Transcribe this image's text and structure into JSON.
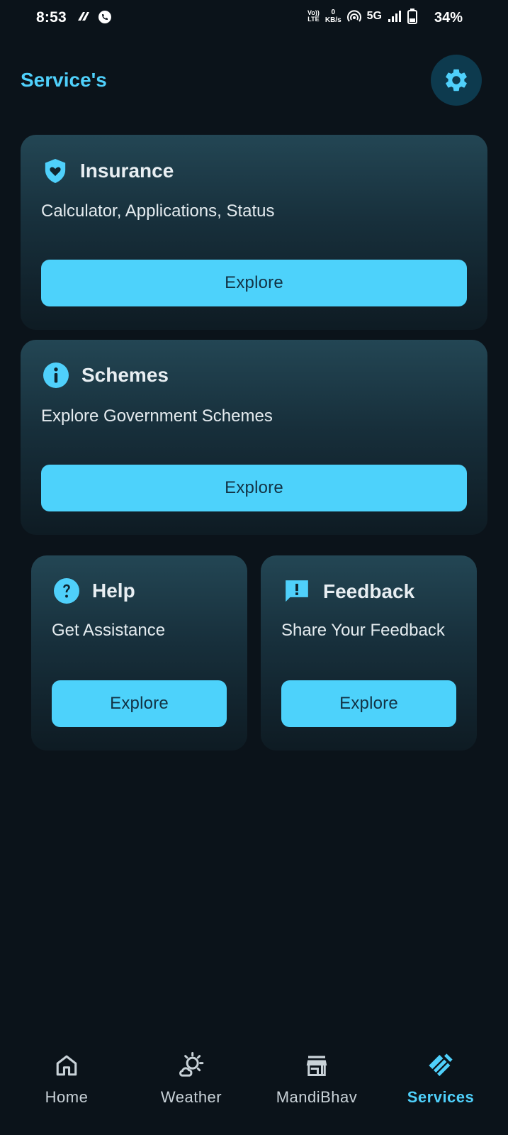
{
  "status_bar": {
    "time": "8:53",
    "volte_top": "Vo))",
    "volte_bottom": "LTE",
    "speed_value": "0",
    "speed_unit": "KB/s",
    "network": "5G",
    "battery": "34%"
  },
  "header": {
    "title": "Service's",
    "settings_icon": "gear-icon"
  },
  "cards": [
    {
      "id": "insurance",
      "icon": "shield-heart-icon",
      "title": "Insurance",
      "subtitle": "Calculator, Applications, Status",
      "button": "Explore"
    },
    {
      "id": "schemes",
      "icon": "info-icon",
      "title": "Schemes",
      "subtitle": "Explore Government Schemes",
      "button": "Explore"
    },
    {
      "id": "help",
      "icon": "help-circle-icon",
      "title": "Help",
      "subtitle": "Get Assistance",
      "button": "Explore"
    },
    {
      "id": "feedback",
      "icon": "feedback-icon",
      "title": "Feedback",
      "subtitle": "Share Your Feedback",
      "button": "Explore"
    }
  ],
  "bottom_nav": [
    {
      "label": "Home",
      "icon": "home-icon",
      "active": false
    },
    {
      "label": "Weather",
      "icon": "weather-icon",
      "active": false
    },
    {
      "label": "MandiBhav",
      "icon": "store-icon",
      "active": false
    },
    {
      "label": "Services",
      "icon": "services-icon",
      "active": true
    }
  ],
  "colors": {
    "background": "#0b131a",
    "accent": "#4fd0fb",
    "button": "#4dd2fb",
    "button_text": "#123244",
    "card_top": "#234654"
  }
}
